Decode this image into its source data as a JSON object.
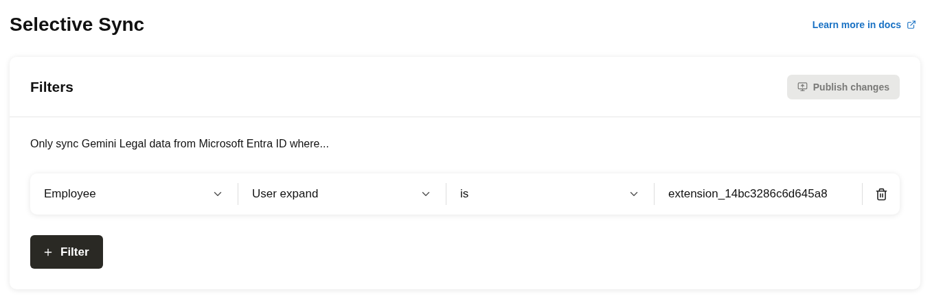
{
  "page_title": "Selective Sync",
  "docs_link": {
    "label": "Learn more in docs"
  },
  "card": {
    "title": "Filters",
    "publish_button": {
      "label": "Publish changes",
      "disabled": true
    },
    "description": "Only sync Gemini Legal data from Microsoft Entra ID where...",
    "filter_rows": [
      {
        "fields": [
          {
            "kind": "select",
            "value": "Employee"
          },
          {
            "kind": "select",
            "value": "User expand"
          },
          {
            "kind": "select",
            "value": "is"
          },
          {
            "kind": "input",
            "value": "extension_14bc3286c6d645a8"
          }
        ]
      }
    ],
    "add_button": {
      "label": "Filter"
    }
  }
}
